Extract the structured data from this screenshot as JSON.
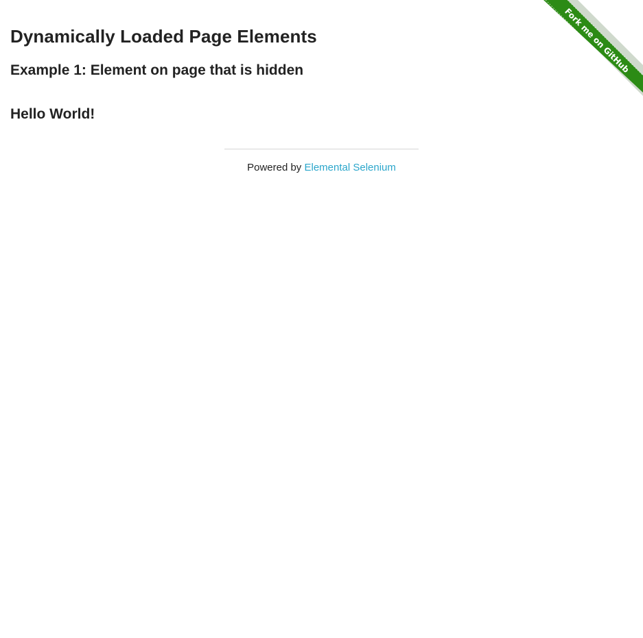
{
  "ribbon": {
    "label": "Fork me on GitHub",
    "color": "#2c8b15"
  },
  "page": {
    "title": "Dynamically Loaded Page Elements",
    "example_heading": "Example 1: Element on page that is hidden",
    "finish_text": "Hello World!"
  },
  "footer": {
    "prefix": "Powered by",
    "link_label": "Elemental Selenium",
    "link_color": "#2ba6cb"
  }
}
